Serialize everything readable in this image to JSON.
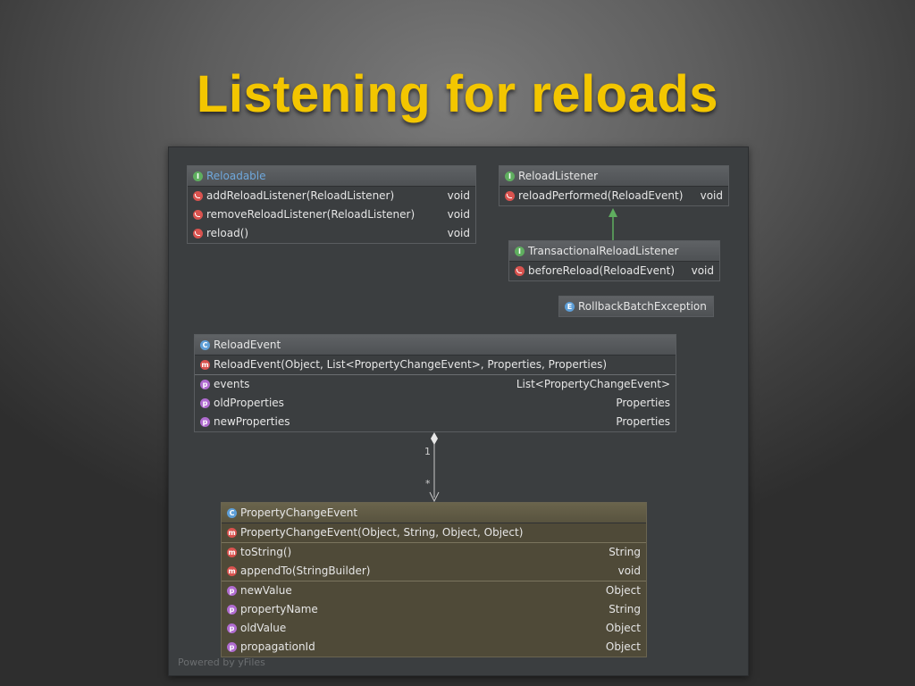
{
  "slide": {
    "title": "Listening for reloads"
  },
  "diagram": {
    "watermark": "Powered by yFiles",
    "reloadable": {
      "name": "Reloadable",
      "icon": "interface-icon",
      "methods": [
        {
          "name": "addReloadListener(ReloadListener)",
          "type": "void",
          "icon": "abstract-method-icon"
        },
        {
          "name": "removeReloadListener(ReloadListener)",
          "type": "void",
          "icon": "abstract-method-icon"
        },
        {
          "name": "reload()",
          "type": "void",
          "icon": "abstract-method-icon"
        }
      ]
    },
    "reload_listener": {
      "name": "ReloadListener",
      "icon": "interface-icon",
      "methods": [
        {
          "name": "reloadPerformed(ReloadEvent)",
          "type": "void",
          "icon": "abstract-method-icon"
        }
      ]
    },
    "transactional_reload_listener": {
      "name": "TransactionalReloadListener",
      "icon": "interface-icon",
      "methods": [
        {
          "name": "beforeReload(ReloadEvent)",
          "type": "void",
          "icon": "abstract-method-icon"
        }
      ]
    },
    "rollback_batch_exception": {
      "name": "RollbackBatchException",
      "icon": "exception-class-icon"
    },
    "reload_event": {
      "name": "ReloadEvent",
      "icon": "class-icon",
      "constructor": "ReloadEvent(Object, List<PropertyChangeEvent>, Properties, Properties)",
      "properties": [
        {
          "name": "events",
          "type": "List<PropertyChangeEvent>",
          "icon": "property-icon"
        },
        {
          "name": "oldProperties",
          "type": "Properties",
          "icon": "property-icon"
        },
        {
          "name": "newProperties",
          "type": "Properties",
          "icon": "property-icon"
        }
      ]
    },
    "association": {
      "source_multiplicity": "1",
      "target_multiplicity": "*"
    },
    "property_change_event": {
      "name": "PropertyChangeEvent",
      "icon": "class-icon",
      "constructor": "PropertyChangeEvent(Object, String, Object, Object)",
      "methods": [
        {
          "name": "toString()",
          "type": "String",
          "icon": "method-icon"
        },
        {
          "name": "appendTo(StringBuilder)",
          "type": "void",
          "icon": "method-icon"
        }
      ],
      "properties": [
        {
          "name": "newValue",
          "type": "Object",
          "icon": "property-icon"
        },
        {
          "name": "propertyName",
          "type": "String",
          "icon": "property-icon"
        },
        {
          "name": "oldValue",
          "type": "Object",
          "icon": "property-icon"
        },
        {
          "name": "propagationId",
          "type": "Object",
          "icon": "property-icon"
        }
      ]
    },
    "colors": {
      "title": "#f3c600",
      "interface_icon": "#5fae5f",
      "class_icon": "#5e9fd8",
      "method_icon": "#d9534f",
      "property_icon": "#b06cd0",
      "inheritance_arrow": "#5fae5f",
      "association_line": "#c8c8c8"
    }
  }
}
